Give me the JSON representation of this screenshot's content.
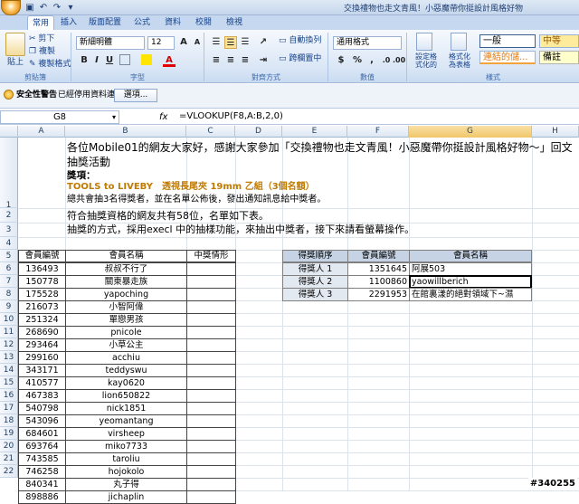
{
  "window": {
    "title": "交換禮物也走文青風！小惡魔帶你挺設計風格好物"
  },
  "tabs": [
    "常用",
    "插入",
    "版面配置",
    "公式",
    "資料",
    "校閱",
    "檢視"
  ],
  "ribbon": {
    "clipboard": {
      "paste": "貼上",
      "cut": "剪下",
      "copy": "複製",
      "format_painter": "複製格式",
      "label": "剪貼簿"
    },
    "font": {
      "name": "新細明體",
      "size": "12",
      "label": "字型",
      "bold": "B",
      "italic": "I",
      "underline": "U",
      "grow": "A",
      "shrink": "A",
      "font_color": "A"
    },
    "alignment": {
      "wrap": "自動換列",
      "merge": "跨欄置中",
      "label": "對齊方式"
    },
    "number": {
      "format": "通用格式",
      "currency": "$",
      "percent": "%",
      "comma": ",",
      "label": "數值"
    },
    "styles": {
      "conditional": "設定格式化的條件",
      "table": "格式化為表格",
      "normal": "一般",
      "neutral": "中等",
      "linked": "連結的儲...",
      "note": "備註",
      "label": "樣式"
    }
  },
  "security": {
    "label": "安全性警告",
    "message": "已經停用資料連線",
    "options_button": "選項..."
  },
  "formula_bar": {
    "name_box": "G8",
    "fx": "fx",
    "formula": "=VLOOKUP(F8,A:B,2,0)"
  },
  "columns": [
    "A",
    "B",
    "C",
    "D",
    "E",
    "F",
    "G",
    "H"
  ],
  "rows": [
    "1",
    "2",
    "3",
    "4",
    "5",
    "6",
    "7",
    "8",
    "9",
    "10",
    "11",
    "12",
    "13",
    "14",
    "15",
    "16",
    "17",
    "18",
    "19",
    "20",
    "21",
    "22"
  ],
  "intro": {
    "headline": "各位Mobile01的網友大家好，感謝大家參加「交換禮物也走文青風！小惡魔帶你挺設計風格好物～」回文抽獎活動",
    "prize_label": "獎項：",
    "prize": "TOOLS to LIVEBY　透視長尾夾 19mm 乙組（3個名額）",
    "note": "總共會抽3名得獎者，並在名單公佈後，發出通知訊息給中獎者。",
    "row2": "符合抽獎資格的網友共有58位，名單如下表。",
    "row3": "抽獎的方式，採用execl 中的抽樣功能，來抽出中獎者，接下來請看螢幕操作。"
  },
  "member_table": {
    "headers": [
      "會員編號",
      "會員名稱",
      "中獎情形"
    ],
    "rows": [
      [
        "136493",
        "叔叔不行了"
      ],
      [
        "150778",
        "關東暴走族"
      ],
      [
        "175528",
        "yapoching"
      ],
      [
        "216073",
        "小智阿偉"
      ],
      [
        "251324",
        "單戀男孩"
      ],
      [
        "268690",
        "pnicole"
      ],
      [
        "293464",
        "小草公主"
      ],
      [
        "299160",
        "acchiu"
      ],
      [
        "343171",
        "teddyswu"
      ],
      [
        "410577",
        "kay0620"
      ],
      [
        "467383",
        "lion650822"
      ],
      [
        "540798",
        "nick1851"
      ],
      [
        "543096",
        "yeomantang"
      ],
      [
        "684601",
        "virsheep"
      ],
      [
        "693764",
        "miko7733"
      ],
      [
        "743585",
        "taroliu"
      ],
      [
        "746258",
        "hojokolo"
      ],
      [
        "840341",
        "丸子得"
      ],
      [
        "898886",
        "jichaplin"
      ]
    ]
  },
  "winner_table": {
    "headers": [
      "得獎順序",
      "會員編號",
      "會員名稱"
    ],
    "rows": [
      [
        "得獎人 1",
        "1351645",
        "阿展503"
      ],
      [
        "得獎人 2",
        "1100860",
        "yaowillberich"
      ],
      [
        "得獎人 3",
        "2291953",
        "在館裏漾的絕對領域下~濕"
      ]
    ]
  },
  "watermark": "#340255",
  "colors": {
    "header_fill": "#c5d3e5",
    "accent_title": "#c07a00",
    "ribbon": "#dbe7f6"
  }
}
